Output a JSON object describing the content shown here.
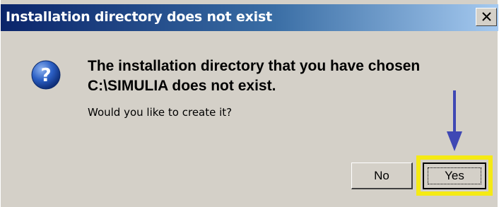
{
  "dialog": {
    "title": "Installation directory does not exist",
    "close_glyph": "×",
    "icon": "question-icon",
    "message_line1": "The installation directory that you have chosen",
    "message_line2": "C:\\SIMULIA does not exist.",
    "prompt": "Would you like to create it?",
    "buttons": {
      "no_label": "No",
      "yes_label": "Yes"
    }
  },
  "annotations": {
    "highlight_color": "#f5ea14",
    "arrow_color": "#3f48b4",
    "arrow_target": "yes-button"
  },
  "colors": {
    "titlebar_start": "#0a246a",
    "dialog_bg": "#d4d0c8"
  }
}
